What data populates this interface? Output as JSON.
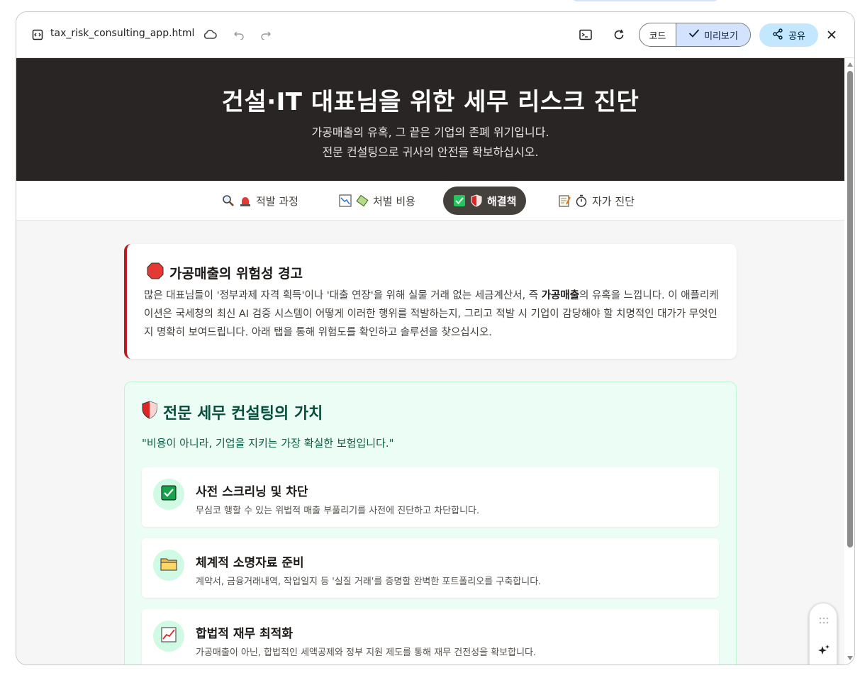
{
  "titlebar": {
    "filename": "tax_risk_consulting_app.html",
    "code_label": "코드",
    "preview_label": "미리보기",
    "share_label": "공유"
  },
  "hero": {
    "title": "건설·IT 대표님을 위한 세무 리스크 진단",
    "subtitle_line1": "가공매출의 유혹, 그 끝은 기업의 존폐 위기입니다.",
    "subtitle_line2": "전문 컨설팅으로 귀사의 안전을 확보하십시오."
  },
  "tabs": [
    {
      "label": "적발 과정",
      "icons": [
        "magnifier-icon",
        "siren-icon"
      ],
      "active": false
    },
    {
      "label": "처벌 비용",
      "icons": [
        "chart-icon",
        "money-icon"
      ],
      "active": false
    },
    {
      "label": "해결책",
      "icons": [
        "check-icon",
        "shield-icon"
      ],
      "active": true
    },
    {
      "label": "자가 진단",
      "icons": [
        "memo-icon",
        "stopwatch-icon"
      ],
      "active": false
    }
  ],
  "warning": {
    "title": "가공매출의 위험성 경고",
    "body_part1": "많은 대표님들이 '정부과제 자격 획득'이나 '대출 연장'을 위해 실물 거래 없는 세금계산서, 즉 ",
    "body_bold": "가공매출",
    "body_part2": "의 유혹을 느낍니다. 이 애플리케이션은 국세청의 최신 AI 검증 시스템이 어떻게 이러한 행위를 적발하는지, 그리고 적발 시 기업이 감당해야 할 치명적인 대가가 무엇인지 명확히 보여드립니다. 아래 탭을 통해 위험도를 확인하고 솔루션을 찾으십시오."
  },
  "value": {
    "title": "전문 세무 컨설팅의 가치",
    "quote": "\"비용이 아니라, 기업을 지키는 가장 확실한 보험입니다.\"",
    "items": [
      {
        "title": "사전 스크리닝 및 차단",
        "desc": "무심코 행할 수 있는 위법적 매출 부풀리기를 사전에 진단하고 차단합니다.",
        "icon": "check-icon"
      },
      {
        "title": "체계적 소명자료 준비",
        "desc": "계약서, 금융거래내역, 작업일지 등 '실질 거래'를 증명할 완벽한 포트폴리오를 구축합니다.",
        "icon": "folder-icon"
      },
      {
        "title": "합법적 재무 최적화",
        "desc": "가공매출이 아닌, 합법적인 세액공제와 정부 지원 제도를 통해 재무 건전성을 확보합니다.",
        "icon": "chart-up-icon"
      }
    ]
  },
  "colors": {
    "hero_bg": "#292524",
    "warn_accent": "#b91c1c",
    "value_bg": "#ecfdf5",
    "tab_active_bg": "#44403c",
    "share_bg": "#c2e7ff"
  }
}
